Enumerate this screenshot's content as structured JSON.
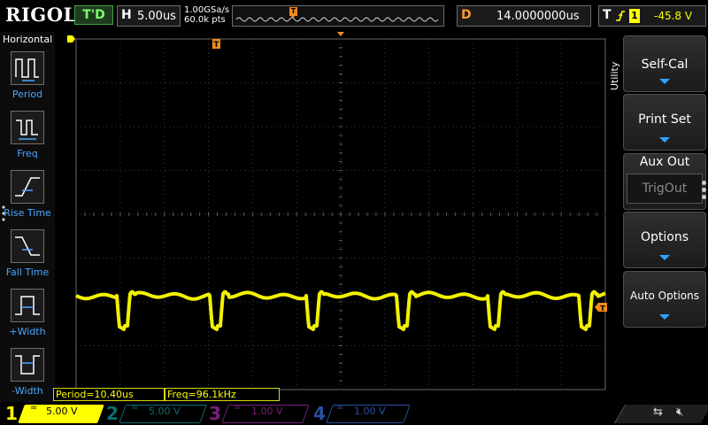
{
  "brand": "RIGOL",
  "run_status": "T'D",
  "timebase": {
    "letter": "H",
    "value": "5.00us"
  },
  "sample": {
    "rate": "1.00GSa/s",
    "points": "60.0k pts"
  },
  "delay": {
    "letter": "D",
    "value": "14.0000000us"
  },
  "trigger": {
    "letter": "T",
    "edge_icon": "rising-edge-icon",
    "source": "1",
    "level": "-45.8 V"
  },
  "trigger_marker": "T",
  "left_panel": {
    "title": "Horizontal",
    "items": [
      {
        "label": "Period",
        "icon": "period-icon"
      },
      {
        "label": "Freq",
        "icon": "frequency-icon"
      },
      {
        "label": "Rise Time",
        "icon": "rise-time-icon"
      },
      {
        "label": "Fall Time",
        "icon": "fall-time-icon"
      },
      {
        "label": "+Width",
        "icon": "positive-width-icon"
      },
      {
        "label": "-Width",
        "icon": "negative-width-icon"
      }
    ]
  },
  "right_menu": {
    "tab": "Utility",
    "buttons": [
      {
        "label": "Self-Cal"
      },
      {
        "label": "Print Set"
      },
      {
        "label": "Aux Out",
        "sub_value": "TrigOut"
      },
      {
        "label": "Options"
      },
      {
        "label": "Auto Options"
      }
    ]
  },
  "measurements": [
    {
      "text": "Period=10.40us"
    },
    {
      "text": "Freq=96.1kHz"
    }
  ],
  "channels": [
    {
      "num": "1",
      "coupling": "=",
      "scale": "5.00 V",
      "color": "#ffff00",
      "active": true
    },
    {
      "num": "2",
      "coupling": "=",
      "scale": "5.00 V",
      "color": "#00c0c0",
      "active": false
    },
    {
      "num": "3",
      "coupling": "=",
      "scale": "1.00 V",
      "color": "#d000d0",
      "active": false
    },
    {
      "num": "4",
      "coupling": "=",
      "scale": "1.00 V",
      "color": "#2060ff",
      "active": false
    }
  ],
  "colors": {
    "ch1": "#ffff00",
    "trigger": "#f28a1e",
    "grid": "#3c3c3c",
    "accent": "#2ea3ff"
  },
  "waveform": {
    "channel": "1",
    "shape": "periodic negative pulse train",
    "period": "10.40us",
    "frequency": "96.1kHz"
  }
}
